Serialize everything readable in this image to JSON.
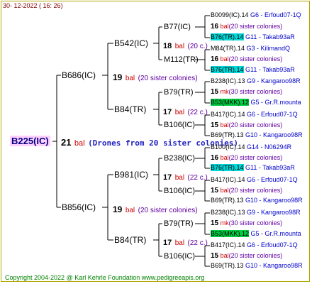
{
  "header": {
    "date": "30- 12-2022 ( 16: 26)"
  },
  "footer": {
    "copyright": "Copyright 2004-2022 @ Karl Kehrle Foundation    www.pedigreeapis.org"
  },
  "root": {
    "label": "B225(IC)",
    "count": "21",
    "bal": "bal",
    "note": "(Drones from 20 sister colonies)"
  },
  "gen1": [
    {
      "label": "B686(IC)",
      "count": "19",
      "bal": "bal",
      "note": "(20 sister colonies)"
    },
    {
      "label": "B856(IC)",
      "count": "19",
      "bal": "bal",
      "note": "(20 sister colonies)"
    }
  ],
  "gen2": [
    {
      "label": "B542(IC)",
      "count": "18",
      "bal": "bal",
      "note": "(20 c.)"
    },
    {
      "label": "B84(TR)",
      "count": "17",
      "bal": "bal",
      "note": "(22 c.)"
    },
    {
      "label": "B981(IC)",
      "count": "17",
      "bal": "bal",
      "note": "(22 c.)"
    },
    {
      "label": "B84(TR)",
      "count": "17",
      "bal": "bal",
      "note": "(22 c.)"
    }
  ],
  "gen3": [
    {
      "label": "B77(IC)"
    },
    {
      "label": "M112(TR)"
    },
    {
      "label": "B79(TR)"
    },
    {
      "label": "B106(IC)"
    },
    {
      "label": "B238(IC)"
    },
    {
      "label": "B106(IC)"
    },
    {
      "label": "B79(TR)"
    },
    {
      "label": "B106(IC)"
    }
  ],
  "queens": [
    {
      "code": "B0099(IC).14",
      "col": "G6 - Erfoud07-1Q"
    },
    {
      "count": "16",
      "bal": "bal",
      "note": "(20 sister colonies)"
    },
    {
      "code": "B76(TR).14",
      "col": "G11 - Takab93aR",
      "hl": "c"
    },
    {
      "code": "M84(TR).14",
      "col": "G3 - KilimandQ"
    },
    {
      "count": "16",
      "bal": "bal",
      "note": "(20 sister colonies)"
    },
    {
      "code": "B76(TR).14",
      "col": "G11 - Takab93aR",
      "hl": "c"
    },
    {
      "code": "B238(IC).13",
      "col": "G9 - Kangaroo98R"
    },
    {
      "count": "15",
      "bal": "mk",
      "note": "(30 sister colonies)"
    },
    {
      "code": "B53(MKK).12",
      "col": "G5 - Gr.R.mounta",
      "hl": "g"
    },
    {
      "code": "B417(IC).14",
      "col": "G6 - Erfoud07-1Q"
    },
    {
      "count": "15",
      "bal": "bal",
      "note": "(20 sister colonies)"
    },
    {
      "code": "B69(TR).13",
      "col": "G10 - Kangaroo98R"
    },
    {
      "code": "B100(IC).14",
      "col": "G14 - N06294R"
    },
    {
      "count": "16",
      "bal": "bal",
      "note": "(20 sister colonies)"
    },
    {
      "code": "B76(TR).14",
      "col": "G11 - Takab93aR",
      "hl": "c"
    },
    {
      "code": "B417(IC).14",
      "col": "G6 - Erfoud07-1Q"
    },
    {
      "count": "15",
      "bal": "bal",
      "note": "(20 sister colonies)"
    },
    {
      "code": "B69(TR).13",
      "col": "G10 - Kangaroo98R"
    },
    {
      "code": "B238(IC).13",
      "col": "G9 - Kangaroo98R"
    },
    {
      "count": "15",
      "bal": "mk",
      "note": "(30 sister colonies)"
    },
    {
      "code": "B53(MKK).12",
      "col": "G5 - Gr.R.mounta",
      "hl": "g"
    },
    {
      "code": "B417(IC).14",
      "col": "G6 - Erfoud07-1Q"
    },
    {
      "count": "15",
      "bal": "bal",
      "note": "(20 sister colonies)"
    },
    {
      "code": "B69(TR).13",
      "col": "G10 - Kangaroo98R"
    }
  ]
}
